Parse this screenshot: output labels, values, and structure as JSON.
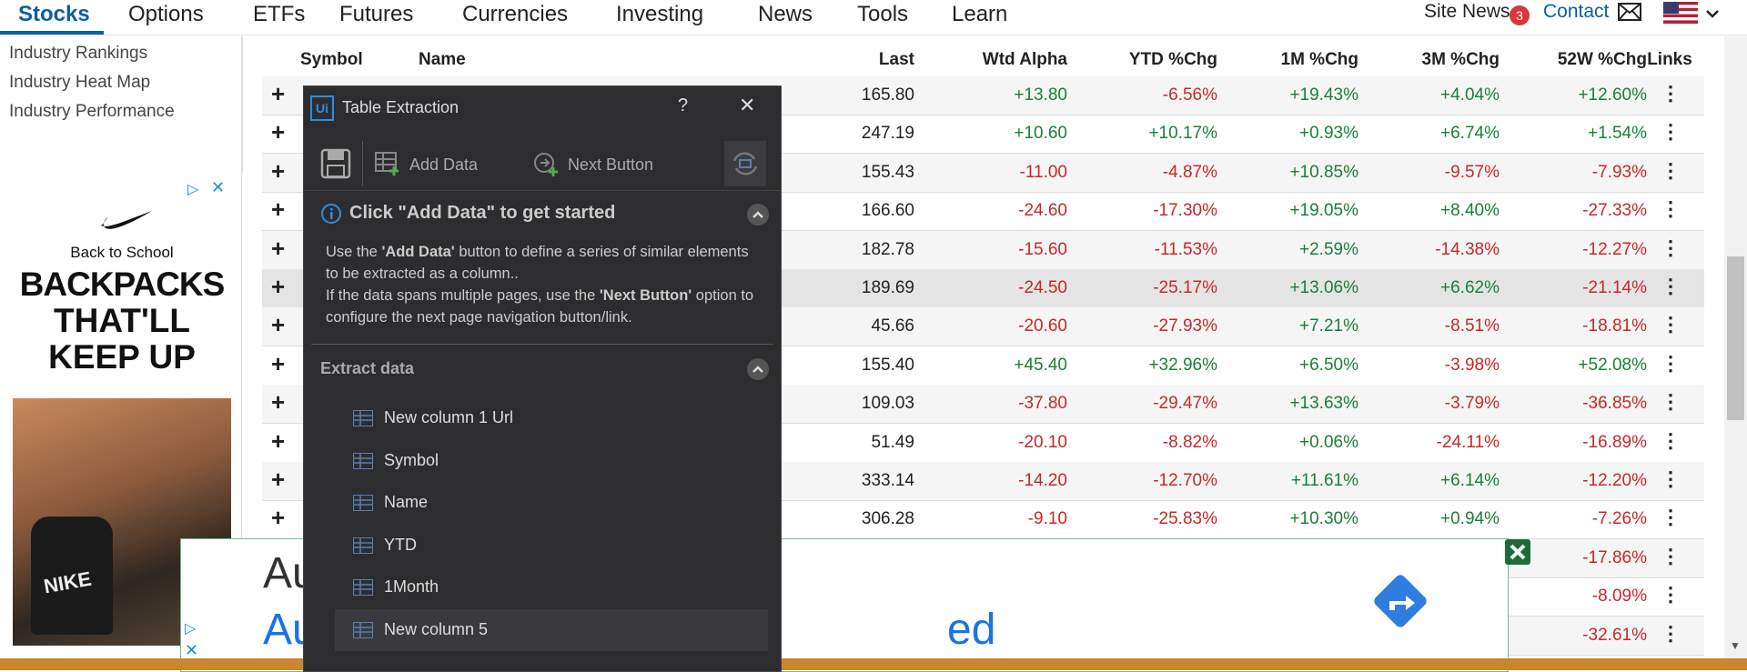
{
  "topnav": {
    "items": [
      "Stocks",
      "Options",
      "ETFs",
      "Futures",
      "Currencies",
      "Investing",
      "News",
      "Tools",
      "Learn"
    ],
    "site_news": "Site News",
    "site_news_count": "3",
    "contact": "Contact"
  },
  "leftmenu": {
    "links": [
      "Industry Rankings",
      "Industry Heat Map",
      "Industry Performance"
    ]
  },
  "side_ad": {
    "line1": "Back to School",
    "line2": "BACKPACKS",
    "line3": "THAT'LL",
    "line4": "KEEP UP",
    "brand": "NIKE"
  },
  "table": {
    "headers": {
      "symbol": "Symbol",
      "name": "Name",
      "last": "Last",
      "wtd_alpha": "Wtd Alpha",
      "ytd": "YTD %Chg",
      "m1": "1M %Chg",
      "m3": "3M %Chg",
      "w52": "52W %Chg",
      "links": "Links"
    },
    "rows": [
      {
        "last": "165.80",
        "wtd": "+13.80",
        "ytd": "-6.56%",
        "m1": "+19.43%",
        "m3": "+4.04%",
        "w52": "+12.60%"
      },
      {
        "last": "247.19",
        "wtd": "+10.60",
        "ytd": "+10.17%",
        "m1": "+0.93%",
        "m3": "+6.74%",
        "w52": "+1.54%"
      },
      {
        "last": "155.43",
        "wtd": "-11.00",
        "ytd": "-4.87%",
        "m1": "+10.85%",
        "m3": "-9.57%",
        "w52": "-7.93%"
      },
      {
        "last": "166.60",
        "wtd": "-24.60",
        "ytd": "-17.30%",
        "m1": "+19.05%",
        "m3": "+8.40%",
        "w52": "-27.33%"
      },
      {
        "last": "182.78",
        "wtd": "-15.60",
        "ytd": "-11.53%",
        "m1": "+2.59%",
        "m3": "-14.38%",
        "w52": "-12.27%"
      },
      {
        "last": "189.69",
        "wtd": "-24.50",
        "ytd": "-25.17%",
        "m1": "+13.06%",
        "m3": "+6.62%",
        "w52": "-21.14%"
      },
      {
        "last": "45.66",
        "wtd": "-20.60",
        "ytd": "-27.93%",
        "m1": "+7.21%",
        "m3": "-8.51%",
        "w52": "-18.81%"
      },
      {
        "last": "155.40",
        "wtd": "+45.40",
        "ytd": "+32.96%",
        "m1": "+6.50%",
        "m3": "-3.98%",
        "w52": "+52.08%"
      },
      {
        "last": "109.03",
        "wtd": "-37.80",
        "ytd": "-29.47%",
        "m1": "+13.63%",
        "m3": "-3.79%",
        "w52": "-36.85%"
      },
      {
        "last": "51.49",
        "wtd": "-20.10",
        "ytd": "-8.82%",
        "m1": "+0.06%",
        "m3": "-24.11%",
        "w52": "-16.89%"
      },
      {
        "last": "333.14",
        "wtd": "-14.20",
        "ytd": "-12.70%",
        "m1": "+11.61%",
        "m3": "+6.14%",
        "w52": "-12.20%"
      },
      {
        "last": "306.28",
        "wtd": "-9.10",
        "ytd": "-25.83%",
        "m1": "+10.30%",
        "m3": "+0.94%",
        "w52": "-7.26%"
      },
      {
        "last": "",
        "wtd": "",
        "ytd": "",
        "m1": "",
        "m3": "",
        "w52": "-17.86%"
      },
      {
        "last": "",
        "wtd": "",
        "ytd": "",
        "m1": "",
        "m3": "",
        "w52": "-8.09%"
      },
      {
        "last": "",
        "wtd": "",
        "ytd": "",
        "m1": "",
        "m3": "",
        "w52": "-32.61%"
      }
    ]
  },
  "bottom_ad": {
    "line1": "Au",
    "line2": "Au",
    "line2_end": "ed"
  },
  "dialog": {
    "logo": "Ui",
    "title": "Table Extraction",
    "help": "?",
    "close": "✕",
    "add_data": "Add Data",
    "next_button": "Next Button",
    "info_heading": "Click \"Add Data\" to get started",
    "info_p1_a": "Use the ",
    "info_p1_b": "'Add Data'",
    "info_p1_c": " button to define a series of similar elements to be extracted as a column..",
    "info_p2_a": "If the data spans multiple pages, use the ",
    "info_p2_b": "'Next Button'",
    "info_p2_c": " option to configure the next page navigation button/link.",
    "extract_heading": "Extract data",
    "columns": [
      "New column 1 Url",
      "Symbol",
      "Name",
      "YTD",
      "1Month",
      "New column 5"
    ]
  },
  "colors": {
    "accent": "#0b5ea8",
    "positive": "#1a7f37",
    "negative": "#c62828",
    "dialog_bg": "#2d2d30"
  }
}
